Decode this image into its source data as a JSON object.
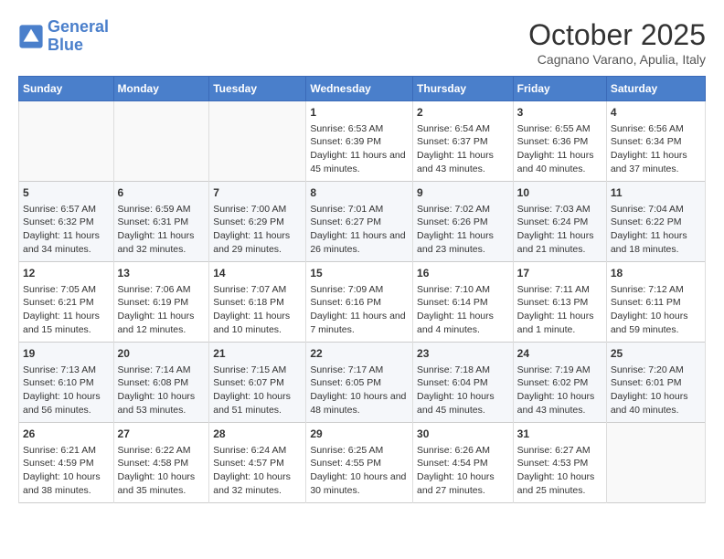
{
  "header": {
    "logo_line1": "General",
    "logo_line2": "Blue",
    "month": "October 2025",
    "location": "Cagnano Varano, Apulia, Italy"
  },
  "weekdays": [
    "Sunday",
    "Monday",
    "Tuesday",
    "Wednesday",
    "Thursday",
    "Friday",
    "Saturday"
  ],
  "weeks": [
    [
      {
        "day": "",
        "sunrise": "",
        "sunset": "",
        "daylight": ""
      },
      {
        "day": "",
        "sunrise": "",
        "sunset": "",
        "daylight": ""
      },
      {
        "day": "",
        "sunrise": "",
        "sunset": "",
        "daylight": ""
      },
      {
        "day": "1",
        "sunrise": "Sunrise: 6:53 AM",
        "sunset": "Sunset: 6:39 PM",
        "daylight": "Daylight: 11 hours and 45 minutes."
      },
      {
        "day": "2",
        "sunrise": "Sunrise: 6:54 AM",
        "sunset": "Sunset: 6:37 PM",
        "daylight": "Daylight: 11 hours and 43 minutes."
      },
      {
        "day": "3",
        "sunrise": "Sunrise: 6:55 AM",
        "sunset": "Sunset: 6:36 PM",
        "daylight": "Daylight: 11 hours and 40 minutes."
      },
      {
        "day": "4",
        "sunrise": "Sunrise: 6:56 AM",
        "sunset": "Sunset: 6:34 PM",
        "daylight": "Daylight: 11 hours and 37 minutes."
      }
    ],
    [
      {
        "day": "5",
        "sunrise": "Sunrise: 6:57 AM",
        "sunset": "Sunset: 6:32 PM",
        "daylight": "Daylight: 11 hours and 34 minutes."
      },
      {
        "day": "6",
        "sunrise": "Sunrise: 6:59 AM",
        "sunset": "Sunset: 6:31 PM",
        "daylight": "Daylight: 11 hours and 32 minutes."
      },
      {
        "day": "7",
        "sunrise": "Sunrise: 7:00 AM",
        "sunset": "Sunset: 6:29 PM",
        "daylight": "Daylight: 11 hours and 29 minutes."
      },
      {
        "day": "8",
        "sunrise": "Sunrise: 7:01 AM",
        "sunset": "Sunset: 6:27 PM",
        "daylight": "Daylight: 11 hours and 26 minutes."
      },
      {
        "day": "9",
        "sunrise": "Sunrise: 7:02 AM",
        "sunset": "Sunset: 6:26 PM",
        "daylight": "Daylight: 11 hours and 23 minutes."
      },
      {
        "day": "10",
        "sunrise": "Sunrise: 7:03 AM",
        "sunset": "Sunset: 6:24 PM",
        "daylight": "Daylight: 11 hours and 21 minutes."
      },
      {
        "day": "11",
        "sunrise": "Sunrise: 7:04 AM",
        "sunset": "Sunset: 6:22 PM",
        "daylight": "Daylight: 11 hours and 18 minutes."
      }
    ],
    [
      {
        "day": "12",
        "sunrise": "Sunrise: 7:05 AM",
        "sunset": "Sunset: 6:21 PM",
        "daylight": "Daylight: 11 hours and 15 minutes."
      },
      {
        "day": "13",
        "sunrise": "Sunrise: 7:06 AM",
        "sunset": "Sunset: 6:19 PM",
        "daylight": "Daylight: 11 hours and 12 minutes."
      },
      {
        "day": "14",
        "sunrise": "Sunrise: 7:07 AM",
        "sunset": "Sunset: 6:18 PM",
        "daylight": "Daylight: 11 hours and 10 minutes."
      },
      {
        "day": "15",
        "sunrise": "Sunrise: 7:09 AM",
        "sunset": "Sunset: 6:16 PM",
        "daylight": "Daylight: 11 hours and 7 minutes."
      },
      {
        "day": "16",
        "sunrise": "Sunrise: 7:10 AM",
        "sunset": "Sunset: 6:14 PM",
        "daylight": "Daylight: 11 hours and 4 minutes."
      },
      {
        "day": "17",
        "sunrise": "Sunrise: 7:11 AM",
        "sunset": "Sunset: 6:13 PM",
        "daylight": "Daylight: 11 hours and 1 minute."
      },
      {
        "day": "18",
        "sunrise": "Sunrise: 7:12 AM",
        "sunset": "Sunset: 6:11 PM",
        "daylight": "Daylight: 10 hours and 59 minutes."
      }
    ],
    [
      {
        "day": "19",
        "sunrise": "Sunrise: 7:13 AM",
        "sunset": "Sunset: 6:10 PM",
        "daylight": "Daylight: 10 hours and 56 minutes."
      },
      {
        "day": "20",
        "sunrise": "Sunrise: 7:14 AM",
        "sunset": "Sunset: 6:08 PM",
        "daylight": "Daylight: 10 hours and 53 minutes."
      },
      {
        "day": "21",
        "sunrise": "Sunrise: 7:15 AM",
        "sunset": "Sunset: 6:07 PM",
        "daylight": "Daylight: 10 hours and 51 minutes."
      },
      {
        "day": "22",
        "sunrise": "Sunrise: 7:17 AM",
        "sunset": "Sunset: 6:05 PM",
        "daylight": "Daylight: 10 hours and 48 minutes."
      },
      {
        "day": "23",
        "sunrise": "Sunrise: 7:18 AM",
        "sunset": "Sunset: 6:04 PM",
        "daylight": "Daylight: 10 hours and 45 minutes."
      },
      {
        "day": "24",
        "sunrise": "Sunrise: 7:19 AM",
        "sunset": "Sunset: 6:02 PM",
        "daylight": "Daylight: 10 hours and 43 minutes."
      },
      {
        "day": "25",
        "sunrise": "Sunrise: 7:20 AM",
        "sunset": "Sunset: 6:01 PM",
        "daylight": "Daylight: 10 hours and 40 minutes."
      }
    ],
    [
      {
        "day": "26",
        "sunrise": "Sunrise: 6:21 AM",
        "sunset": "Sunset: 4:59 PM",
        "daylight": "Daylight: 10 hours and 38 minutes."
      },
      {
        "day": "27",
        "sunrise": "Sunrise: 6:22 AM",
        "sunset": "Sunset: 4:58 PM",
        "daylight": "Daylight: 10 hours and 35 minutes."
      },
      {
        "day": "28",
        "sunrise": "Sunrise: 6:24 AM",
        "sunset": "Sunset: 4:57 PM",
        "daylight": "Daylight: 10 hours and 32 minutes."
      },
      {
        "day": "29",
        "sunrise": "Sunrise: 6:25 AM",
        "sunset": "Sunset: 4:55 PM",
        "daylight": "Daylight: 10 hours and 30 minutes."
      },
      {
        "day": "30",
        "sunrise": "Sunrise: 6:26 AM",
        "sunset": "Sunset: 4:54 PM",
        "daylight": "Daylight: 10 hours and 27 minutes."
      },
      {
        "day": "31",
        "sunrise": "Sunrise: 6:27 AM",
        "sunset": "Sunset: 4:53 PM",
        "daylight": "Daylight: 10 hours and 25 minutes."
      },
      {
        "day": "",
        "sunrise": "",
        "sunset": "",
        "daylight": ""
      }
    ]
  ]
}
